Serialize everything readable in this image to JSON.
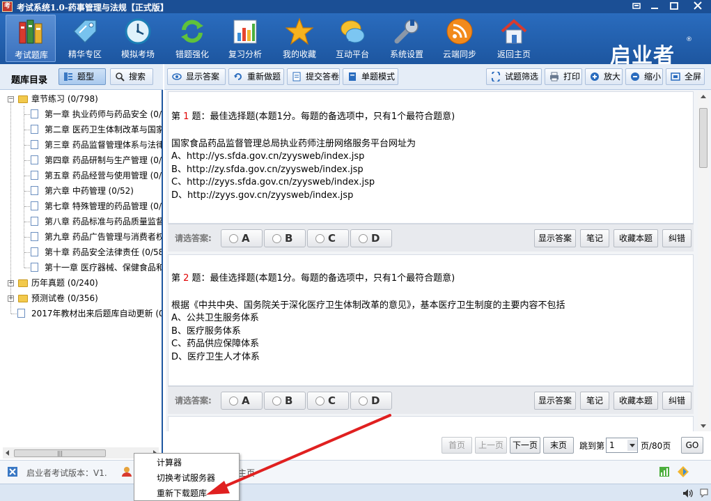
{
  "window": {
    "title": "考试系统1.0-药事管理与法规【正式版】",
    "app_icon_glyph": "考"
  },
  "ribbon": {
    "items": [
      {
        "label": "考试题库",
        "icon": "books-icon"
      },
      {
        "label": "精华专区",
        "icon": "tag-icon"
      },
      {
        "label": "模拟考场",
        "icon": "clock-icon"
      },
      {
        "label": "错题强化",
        "icon": "refresh-icon"
      },
      {
        "label": "复习分析",
        "icon": "bar-chart-icon"
      },
      {
        "label": "我的收藏",
        "icon": "star-icon"
      },
      {
        "label": "互动平台",
        "icon": "chat-bubbles-icon"
      },
      {
        "label": "系统设置",
        "icon": "wrench-icon"
      },
      {
        "label": "云端同步",
        "icon": "rss-icon"
      },
      {
        "label": "返回主页",
        "icon": "home-icon"
      }
    ],
    "brand": "启业者",
    "brand_mark": "®"
  },
  "left_panel": {
    "title": "题库目录",
    "type_button": "题型",
    "search_button": "搜索",
    "tree": [
      {
        "label": "章节练习 (0/798)",
        "level": 0,
        "kind": "folder",
        "expanded": true
      },
      {
        "label": "第一章  执业药师与药品安全 (0/",
        "level": 1,
        "kind": "doc"
      },
      {
        "label": "第二章  医药卫生体制改革与国家",
        "level": 1,
        "kind": "doc"
      },
      {
        "label": "第三章  药品监督管理体系与法律",
        "level": 1,
        "kind": "doc"
      },
      {
        "label": "第四章  药品研制与生产管理 (0/",
        "level": 1,
        "kind": "doc"
      },
      {
        "label": "第五章  药品经营与使用管理 (0/",
        "level": 1,
        "kind": "doc"
      },
      {
        "label": "第六章  中药管理 (0/52)",
        "level": 1,
        "kind": "doc"
      },
      {
        "label": "第七章  特殊管理的药品管理 (0/",
        "level": 1,
        "kind": "doc"
      },
      {
        "label": "第八章  药品标准与药品质量监督",
        "level": 1,
        "kind": "doc"
      },
      {
        "label": "第九章  药品广告管理与消费者权",
        "level": 1,
        "kind": "doc"
      },
      {
        "label": "第十章  药品安全法律责任 (0/58",
        "level": 1,
        "kind": "doc"
      },
      {
        "label": "第十一章  医疗器械、保健食品和",
        "level": 1,
        "kind": "doc"
      },
      {
        "label": "历年真题 (0/240)",
        "level": 0,
        "kind": "folder",
        "expanded": false
      },
      {
        "label": "预测试卷 (0/356)",
        "level": 0,
        "kind": "folder",
        "expanded": false
      },
      {
        "label": "2017年教材出来后题库自动更新 (0/",
        "level": 0,
        "kind": "doc"
      }
    ]
  },
  "toolbar": {
    "show_answer": "显示答案",
    "redo": "重新做题",
    "submit": "提交答卷",
    "single_mode": "单题模式",
    "filter": "试题筛选",
    "print": "打印",
    "zoom_in": "放大",
    "zoom_out": "缩小",
    "fullscreen": "全屏"
  },
  "questions": [
    {
      "prefix": "第 ",
      "number": "1",
      "header": " 题：最佳选择题(本题1分。每题的备选项中，只有1个最符合题意)",
      "stem": "国家食品药品监督管理总局执业药师注册网络服务平台网址为",
      "options": [
        "A、http://ys.sfda.gov.cn/zyysweb/index.jsp",
        "B、http://zy.sfda.gov.cn/zyysweb/index.jsp",
        "C、http://zyys.sfda.gov.cn/zyysweb/index.jsp",
        "D、http://zyys.gov.cn/zyysweb/index.jsp"
      ]
    },
    {
      "prefix": "第 ",
      "number": "2",
      "header": " 题：最佳选择题(本题1分。每题的备选项中，只有1个最符合题意)",
      "stem": "根据《中共中央、国务院关于深化医疗卫生体制改革的意见》，基本医疗卫生制度的主要内容不包括",
      "options": [
        "A、公共卫生服务体系",
        "B、医疗服务体系",
        "C、药品供应保障体系",
        "D、医疗卫生人才体系"
      ]
    }
  ],
  "answer_bar": {
    "prompt": "请选答案:",
    "choices": [
      "A",
      "B",
      "C",
      "D"
    ],
    "show_answer": "显示答案",
    "notes": "笔记",
    "favorite": "收藏本题",
    "report": "纠错"
  },
  "pager": {
    "first": "首页",
    "prev": "上一页",
    "next": "下一页",
    "last": "末页",
    "jump_to": "跳到第",
    "current_page": "1",
    "total": "页/80页",
    "go": "GO"
  },
  "status": {
    "version_text": "启业者考试版本：V1.",
    "extra_text": "主页"
  },
  "context_menu": {
    "items": [
      "计算器",
      "切换考试服务器",
      "重新下载题库"
    ]
  },
  "colors": {
    "title_bar": "#1b4f95",
    "ribbon": "#1d56a0",
    "question_number": "#e00000",
    "annotation_arrow": "#e02020"
  }
}
